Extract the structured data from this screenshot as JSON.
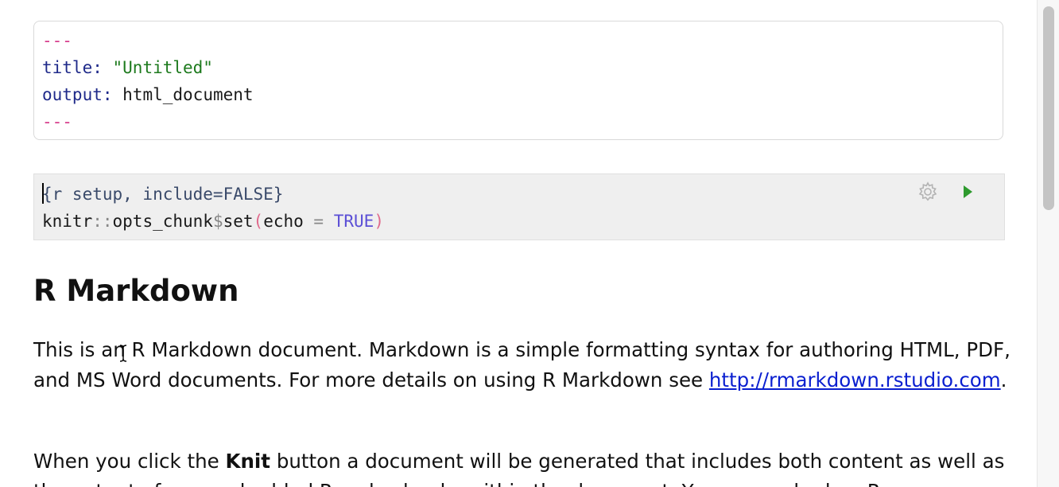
{
  "yaml": {
    "open_dashes": "---",
    "title_key": "title:",
    "title_value": "\"Untitled\"",
    "output_key": "output:",
    "output_value": "html_document",
    "close_dashes": "---"
  },
  "chunk": {
    "header": "{r setup, include=FALSE}",
    "code_1": "knitr",
    "code_2": "::",
    "code_3": "opts_chunk",
    "code_4": "$",
    "code_5": "set",
    "code_6": "(",
    "code_7": "echo ",
    "code_8": "=",
    "code_9": " ",
    "code_10": "TRUE",
    "code_11": ")",
    "settings_icon": "gear-icon",
    "run_icon": "play-icon",
    "run_color": "#2e9a2e"
  },
  "document": {
    "heading": "R Markdown",
    "para1_text": "This is an R Markdown document. Markdown is a simple formatting syntax for authoring HTML, PDF, and MS Word documents. For more details on using R Markdown see ",
    "para1_link": "http://rmarkdown.rstudio.com",
    "para1_end": ".",
    "para2_start": "When you click the ",
    "para2_bold": "Knit",
    "para2_rest": " button a document will be generated that includes both content as well as the output of any embedded R code chunks within the document. You can embed an R"
  },
  "colors": {
    "link": "#0a1fd0",
    "yaml_dash": "#d63a8a",
    "yaml_key": "#1f2a8a",
    "yaml_string": "#1d7a1d"
  }
}
